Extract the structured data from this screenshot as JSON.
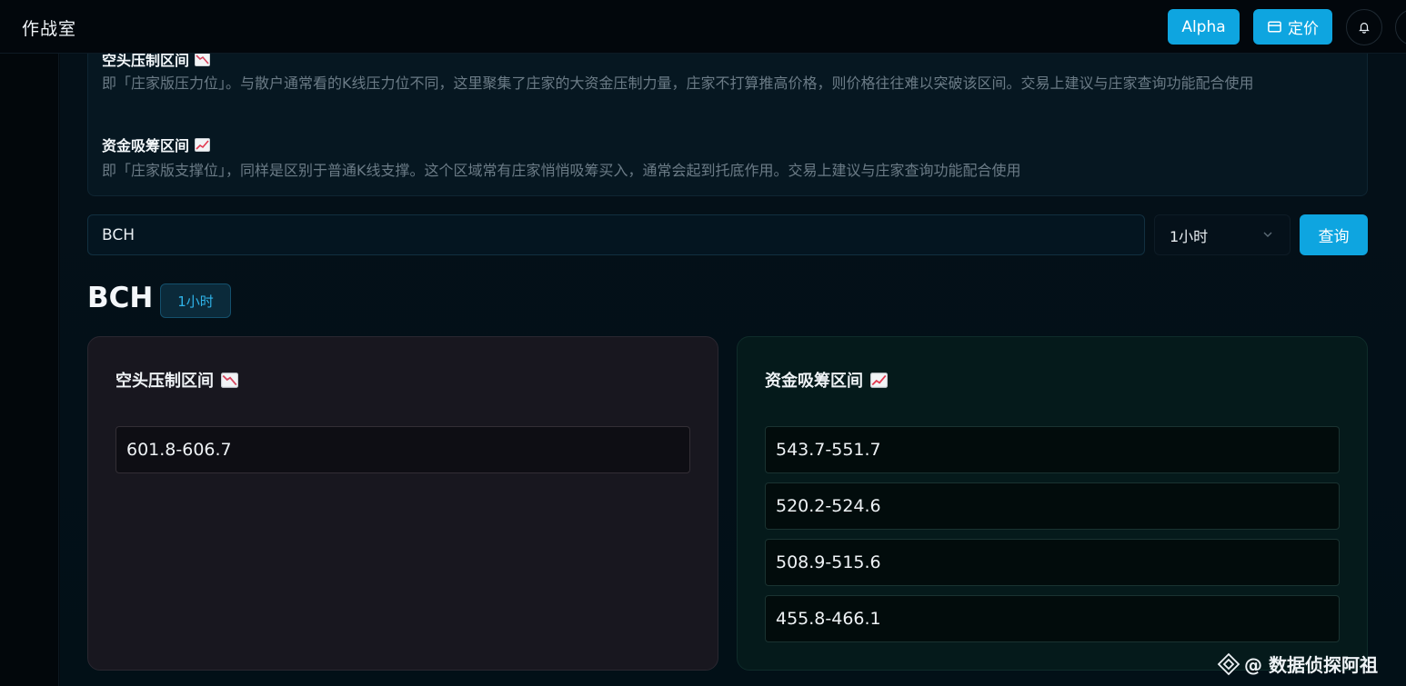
{
  "header": {
    "brand": "作战室",
    "alpha_label": "Alpha",
    "pricing_label": "定价",
    "icons": [
      "card-icon",
      "bell-icon"
    ]
  },
  "info": {
    "resist_title": "空头压制区间",
    "resist_desc": "即「庄家版压力位」。与散户通常看的K线压力位不同，这里聚集了庄家的大资金压制力量，庄家不打算推高价格，则价格往往难以突破该区间。交易上建议与庄家查询功能配合使用",
    "support_title": "资金吸筹区间",
    "support_desc": "即「庄家版支撑位」，同样是区别于普通K线支撑。这个区域常有庄家悄悄吸筹买入，通常会起到托底作用。交易上建议与庄家查询功能配合使用"
  },
  "query": {
    "symbol_value": "BCH",
    "interval_value": "1小时",
    "submit_label": "查询"
  },
  "result": {
    "symbol": "BCH",
    "interval_badge": "1小时",
    "resist": {
      "title": "空头压制区间",
      "zones": [
        "601.8-606.7"
      ]
    },
    "support": {
      "title": "资金吸筹区间",
      "zones": [
        "543.7-551.7",
        "520.2-524.6",
        "508.9-515.6",
        "455.8-466.1"
      ]
    }
  },
  "watermark": {
    "text": "@ 数据侦探阿祖"
  },
  "colors": {
    "accent": "#0ea5e0",
    "resist_card_bg": "#18171f",
    "support_card_bg": "#051a1b",
    "chart_down_red": "#d6455d",
    "chart_up_red": "#e2384f"
  }
}
